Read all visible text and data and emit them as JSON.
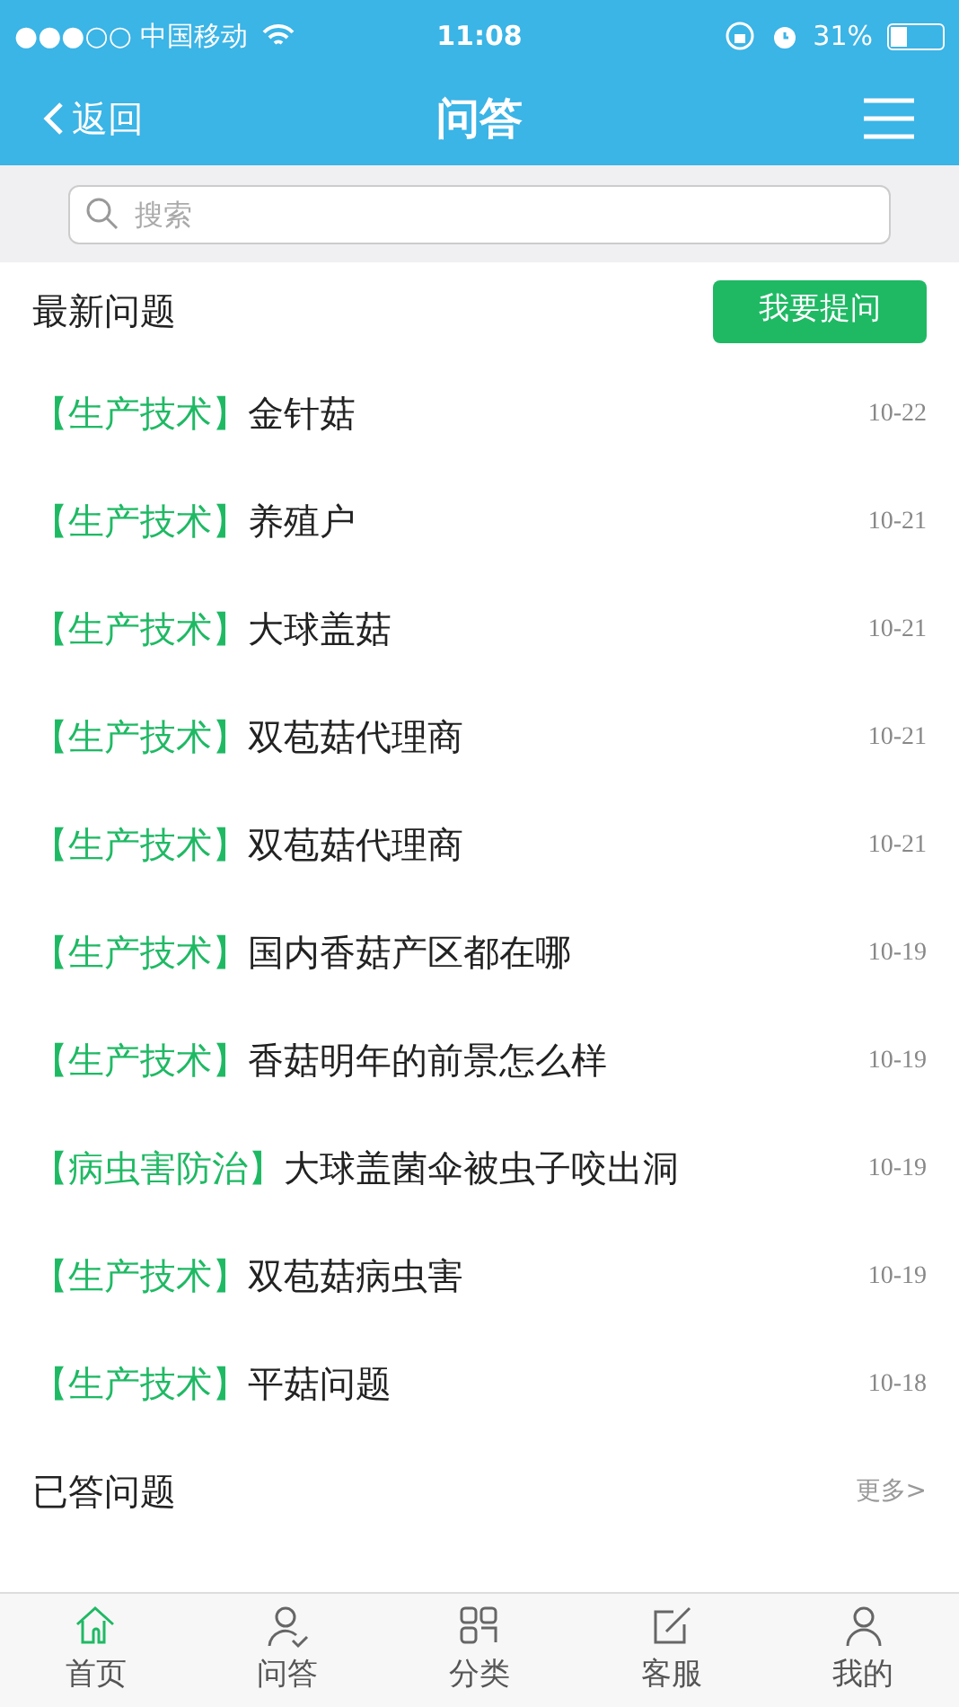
{
  "status_bar": {
    "carrier": "●●●○○ 中国移动",
    "time": "11:08",
    "battery": "31%"
  },
  "nav": {
    "back": "返回",
    "title": "问答"
  },
  "search": {
    "placeholder": "搜索"
  },
  "latest": {
    "title": "最新问题",
    "ask_button": "我要提问",
    "items": [
      {
        "category": "【生产技术】",
        "title": "金针菇",
        "date": "10-22"
      },
      {
        "category": "【生产技术】",
        "title": "养殖户",
        "date": "10-21"
      },
      {
        "category": "【生产技术】",
        "title": "大球盖菇",
        "date": "10-21"
      },
      {
        "category": "【生产技术】",
        "title": "双苞菇代理商",
        "date": "10-21"
      },
      {
        "category": "【生产技术】",
        "title": "双苞菇代理商",
        "date": "10-21"
      },
      {
        "category": "【生产技术】",
        "title": "国内香菇产区都在哪",
        "date": "10-19"
      },
      {
        "category": "【生产技术】",
        "title": "香菇明年的前景怎么样",
        "date": "10-19"
      },
      {
        "category": "【病虫害防治】",
        "title": "大球盖菌伞被虫子咬出洞",
        "date": "10-19"
      },
      {
        "category": "【生产技术】",
        "title": "双苞菇病虫害",
        "date": "10-19"
      },
      {
        "category": "【生产技术】",
        "title": "平菇问题",
        "date": "10-18"
      }
    ]
  },
  "answered": {
    "title": "已答问题",
    "more": "更多>"
  },
  "tab_bar": [
    {
      "label": "首页",
      "selected": true
    },
    {
      "label": "问答",
      "selected": false
    },
    {
      "label": "分类",
      "selected": false
    },
    {
      "label": "客服",
      "selected": false
    },
    {
      "label": "我的",
      "selected": false
    }
  ]
}
